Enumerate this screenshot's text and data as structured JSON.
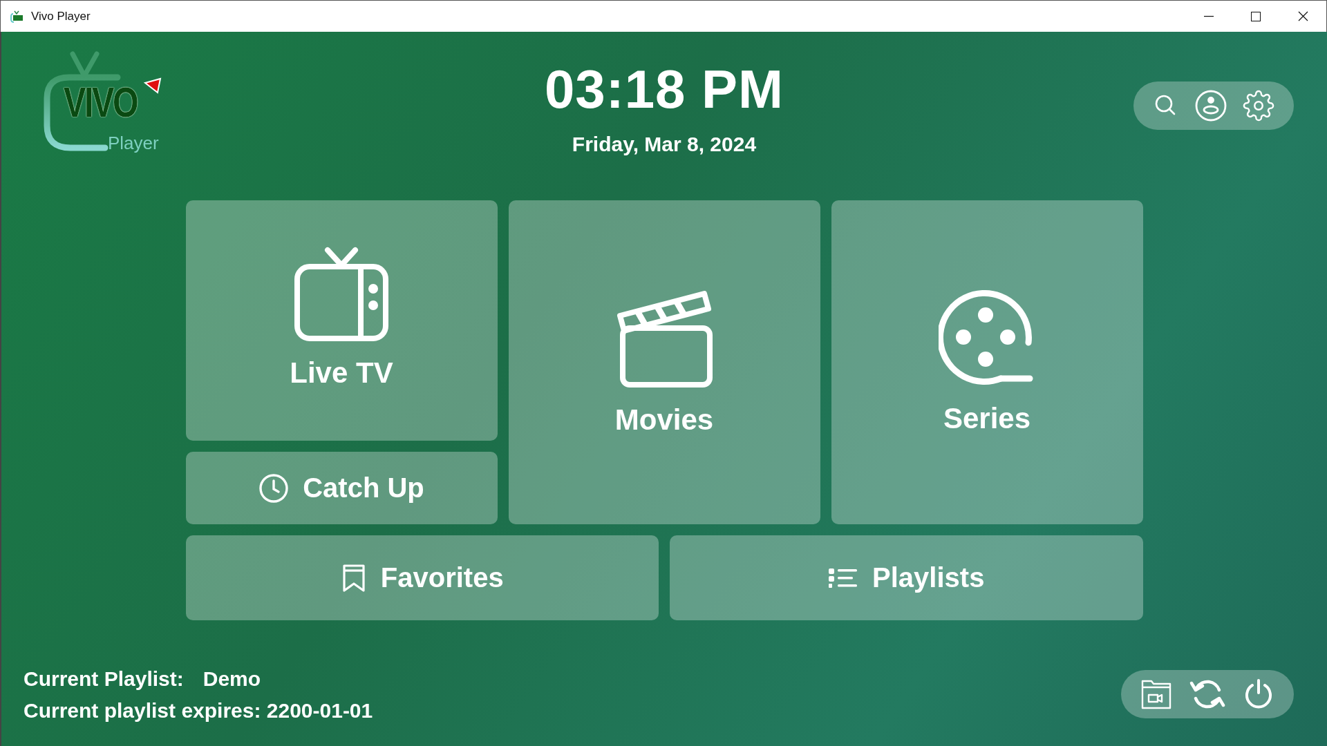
{
  "window": {
    "title": "Vivo Player"
  },
  "logo": {
    "wordmark": "VIVO",
    "subtitle": "Player"
  },
  "clock": {
    "time": "03:18 PM",
    "date": "Friday, Mar 8, 2024"
  },
  "top_actions": [
    {
      "kind": "search"
    },
    {
      "kind": "account"
    },
    {
      "kind": "settings"
    }
  ],
  "tiles": [
    {
      "kind": "live",
      "label": "Live TV"
    },
    {
      "kind": "movies",
      "label": "Movies"
    },
    {
      "kind": "series",
      "label": "Series"
    },
    {
      "kind": "catchup",
      "label": "Catch Up"
    },
    {
      "kind": "favorites",
      "label": "Favorites"
    },
    {
      "kind": "playlists",
      "label": "Playlists"
    }
  ],
  "footer": {
    "playlist_label": "Current Playlist:",
    "playlist_name": "Demo",
    "expiry": "Current playlist expires: 2200-01-01"
  },
  "bottom_actions": [
    {
      "kind": "media-folder"
    },
    {
      "kind": "refresh"
    },
    {
      "kind": "power"
    }
  ]
}
